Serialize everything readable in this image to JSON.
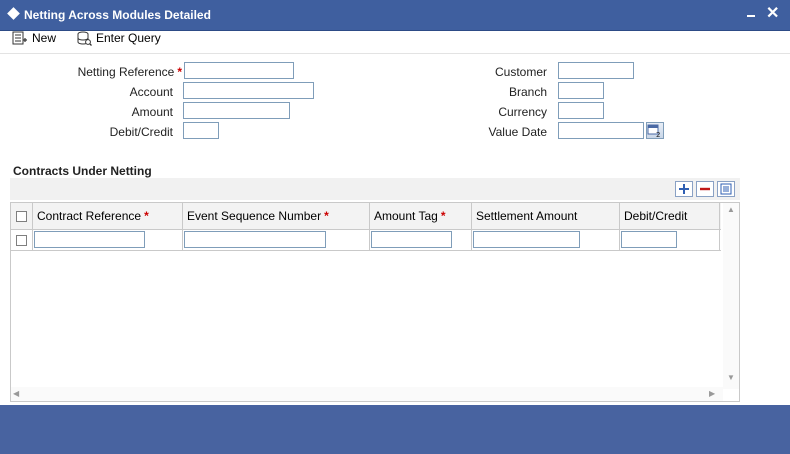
{
  "window": {
    "title": "Netting Across Modules Detailed",
    "min_icon": "minimize-icon",
    "close_glyph": "✕"
  },
  "toolbar": {
    "new_label": "New",
    "enter_query_label": "Enter Query"
  },
  "form": {
    "netting_reference_label": "Netting Reference",
    "account_label": "Account",
    "amount_label": "Amount",
    "debit_credit_label": "Debit/Credit",
    "customer_label": "Customer",
    "branch_label": "Branch",
    "currency_label": "Currency",
    "value_date_label": "Value Date",
    "required_mark": "*"
  },
  "contracts": {
    "section_title": "Contracts Under Netting",
    "columns": [
      {
        "label": "Contract Reference",
        "required": true
      },
      {
        "label": "Event Sequence Number",
        "required": true
      },
      {
        "label": "Amount Tag",
        "required": true
      },
      {
        "label": "Settlement Amount",
        "required": false
      },
      {
        "label": "Debit/Credit",
        "required": false
      }
    ]
  },
  "colors": {
    "title_bar": "#3f5f9f",
    "footer": "#4863a0",
    "required": "#cc0000"
  }
}
